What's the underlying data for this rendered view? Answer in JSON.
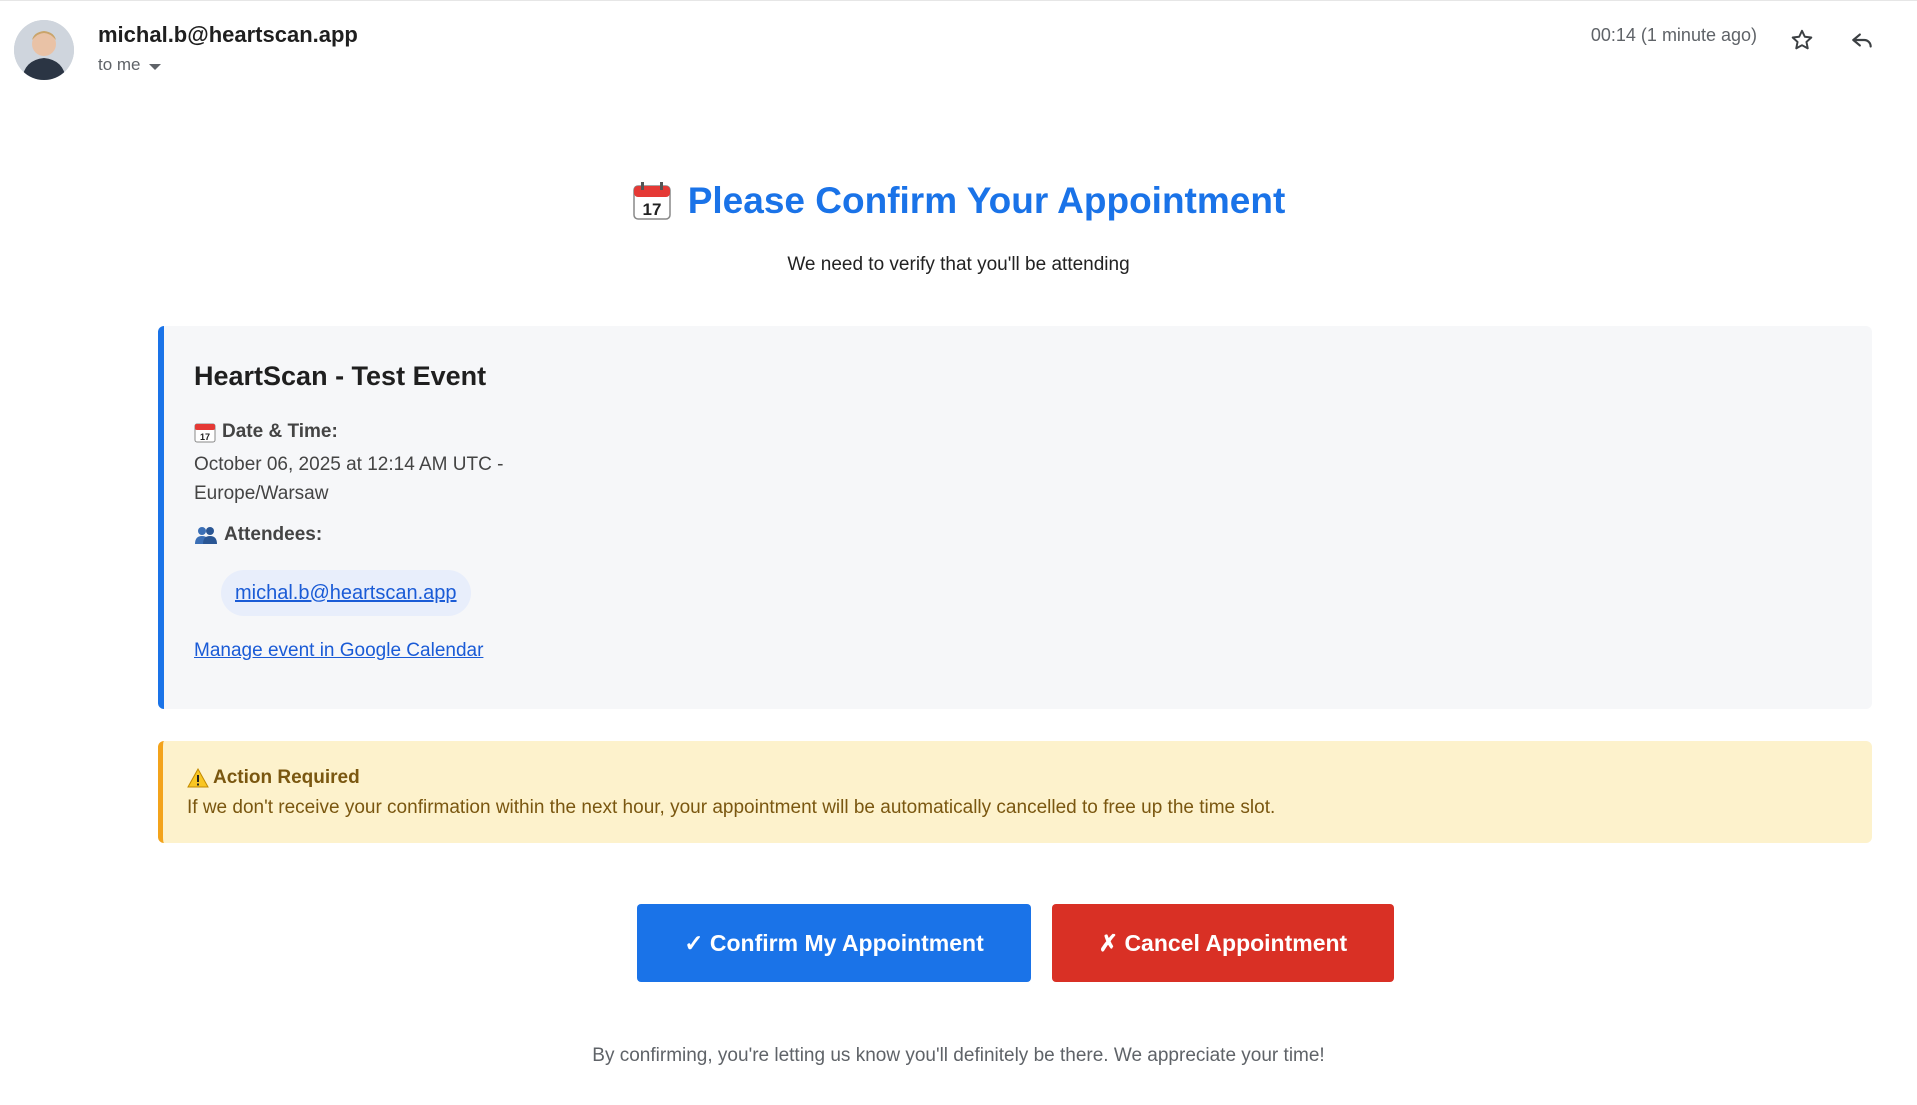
{
  "header": {
    "sender": "michal.b@heartscan.app",
    "recipient_label": "to me",
    "timestamp": "00:14 (1 minute ago)"
  },
  "email": {
    "title": "Please Confirm Your Appointment",
    "subtitle": "We need to verify that you'll be attending",
    "event": {
      "name": "HeartScan - Test Event",
      "datetime_label": "Date & Time:",
      "datetime_value": "October 06, 2025 at 12:14 AM UTC - Europe/Warsaw",
      "attendees_label": "Attendees:",
      "attendees": [
        "michal.b@heartscan.app"
      ],
      "manage_link": "Manage event in Google Calendar"
    },
    "warning": {
      "title": "Action Required",
      "text": "If we don't receive your confirmation within the next hour, your appointment will be automatically cancelled to free up the time slot."
    },
    "buttons": {
      "confirm": "✓ Confirm My Appointment",
      "cancel": "✗ Cancel Appointment"
    },
    "footer": "By confirming, you're letting us know you'll definitely be there. We appreciate your time!"
  },
  "colors": {
    "accent_blue": "#1a73e8",
    "cancel_red": "#d93025",
    "warning_bg": "#fdf2cc",
    "warning_border": "#f3a31b",
    "card_bg": "#f6f7f9"
  },
  "icons": {
    "avatar": "avatar",
    "star": "star-icon",
    "reply": "reply-icon",
    "calendar": "calendar-icon",
    "attendees": "people-icon",
    "warning": "warning-icon"
  }
}
